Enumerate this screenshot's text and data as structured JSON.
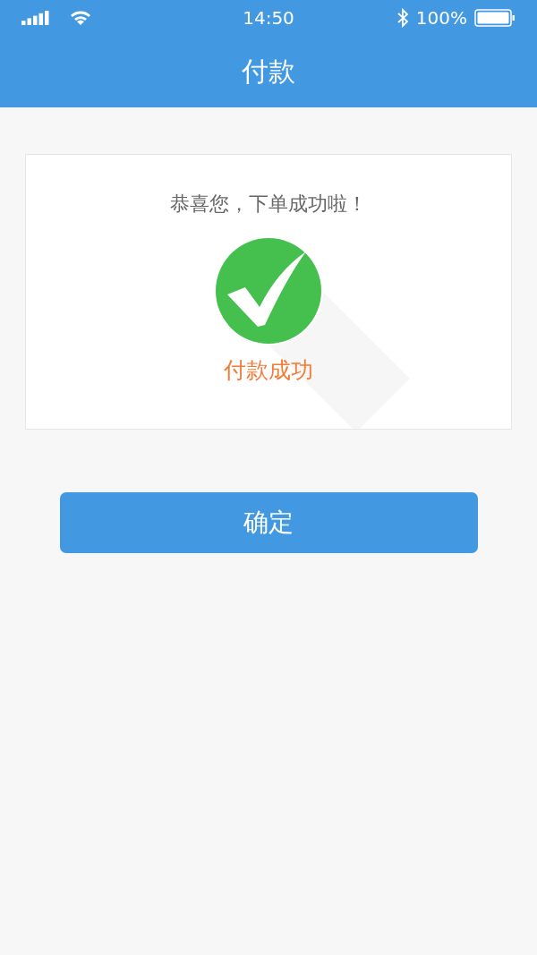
{
  "status_bar": {
    "time": "14:50",
    "battery": "100%"
  },
  "nav_bar": {
    "title": "付款"
  },
  "result_card": {
    "message": "恭喜您，下单成功啦！",
    "status": "付款成功"
  },
  "confirm_button": {
    "label": "确定"
  }
}
